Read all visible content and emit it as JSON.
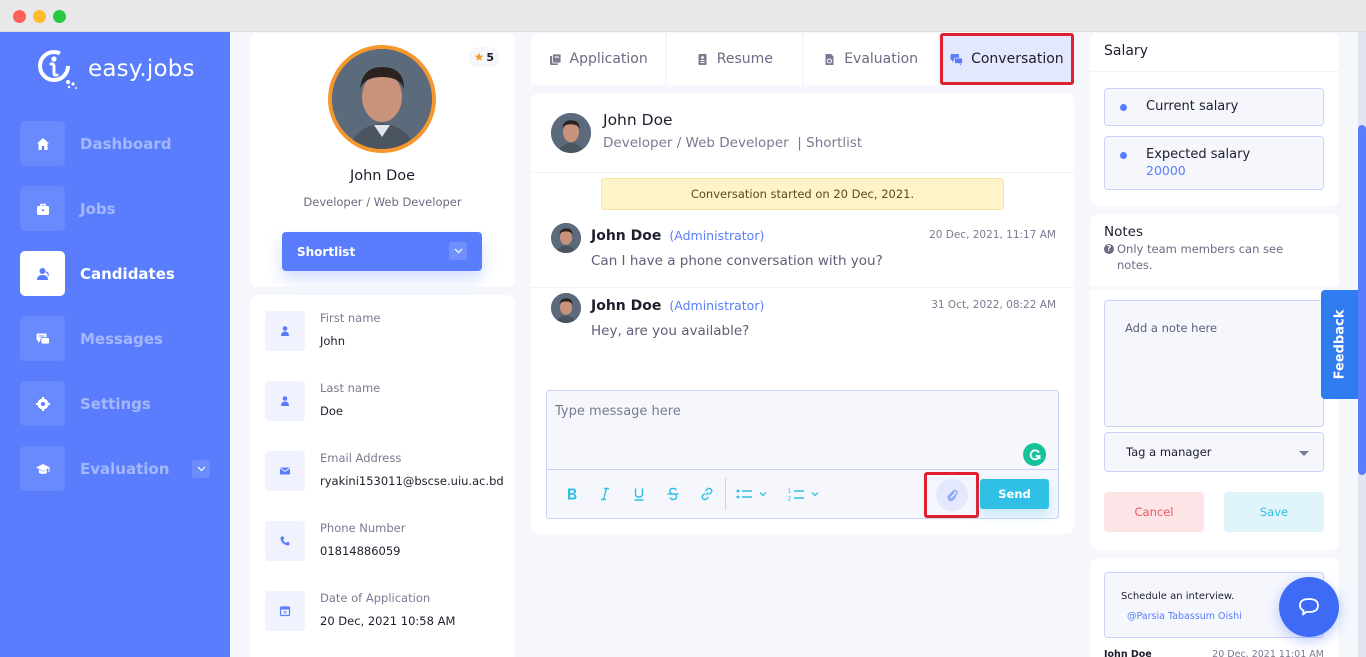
{
  "window": {
    "controls": [
      "close",
      "minimize",
      "maximize"
    ]
  },
  "brand": {
    "name": "easy.jobs",
    "icon": "easyjobs-logo-icon"
  },
  "sidebar": {
    "items": [
      {
        "label": "Dashboard",
        "icon": "home-icon",
        "active": false
      },
      {
        "label": "Jobs",
        "icon": "briefcase-icon",
        "active": false
      },
      {
        "label": "Candidates",
        "icon": "user-icon",
        "active": true
      },
      {
        "label": "Messages",
        "icon": "chat-icon",
        "active": false
      },
      {
        "label": "Settings",
        "icon": "gear-icon",
        "active": false
      },
      {
        "label": "Evaluation",
        "icon": "graduation-cap-icon",
        "active": false,
        "has_dropdown": true
      }
    ]
  },
  "profile": {
    "rating": "5",
    "name": "John Doe",
    "role": "Developer / Web Developer",
    "status": "Shortlist"
  },
  "info": [
    {
      "label": "First name",
      "value": "John",
      "icon": "user-icon"
    },
    {
      "label": "Last name",
      "value": "Doe",
      "icon": "user-icon"
    },
    {
      "label": "Email Address",
      "value": "ryakini153011@bscse.uiu.ac.bd",
      "icon": "envelope-icon"
    },
    {
      "label": "Phone Number",
      "value": "01814886059",
      "icon": "phone-icon"
    },
    {
      "label": "Date of Application",
      "value": "20 Dec, 2021 10:58 AM",
      "icon": "calendar-icon"
    }
  ],
  "tabs": [
    {
      "label": "Application",
      "icon": "document-icon",
      "active": false
    },
    {
      "label": "Resume",
      "icon": "resume-icon",
      "active": false
    },
    {
      "label": "Evaluation",
      "icon": "evaluation-icon",
      "active": false
    },
    {
      "label": "Conversation",
      "icon": "conversation-icon",
      "active": true
    }
  ],
  "conversation": {
    "header_name": "John Doe",
    "header_sub": "Developer / Web Developer  | Shortlist",
    "started_notice": "Conversation started on 20 Dec, 2021.",
    "messages": [
      {
        "author": "John Doe",
        "role": "(Administrator)",
        "time": "20 Dec, 2021, 11:17 AM",
        "text": "Can I have a phone conversation with you?"
      },
      {
        "author": "John Doe",
        "role": "(Administrator)",
        "time": "31 Oct, 2022, 08:22 AM",
        "text": "Hey, are you available?"
      }
    ],
    "composer": {
      "placeholder": "Type message here",
      "value": "",
      "tools": [
        "bold",
        "italic",
        "underline",
        "strikethrough",
        "link",
        "bullet-list",
        "numbered-list"
      ],
      "send_label": "Send"
    }
  },
  "salary": {
    "title": "Salary",
    "current_label": "Current salary",
    "current_value": "",
    "expected_label": "Expected salary",
    "expected_value": "20000"
  },
  "notes": {
    "title": "Notes",
    "hint": "Only team members can see notes.",
    "placeholder": "Add a note here",
    "value": "",
    "tag_placeholder": "Tag a manager",
    "cancel_label": "Cancel",
    "save_label": "Save",
    "items": [
      {
        "text": "Schedule an interview.",
        "mention": "@Parsia Tabassum Oishi",
        "author": "John Doe",
        "date": "20 Dec, 2021 11:01 AM"
      }
    ]
  },
  "feedback_label": "Feedback",
  "colors": {
    "primary": "#597dfc",
    "accent_orange": "#f6972c",
    "send": "#30bfe5",
    "highlight_red": "#e0202f",
    "grammarly": "#15c39a"
  }
}
